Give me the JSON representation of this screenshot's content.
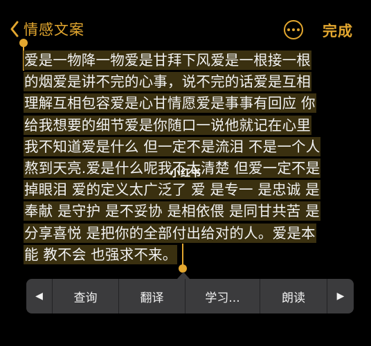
{
  "nav": {
    "back_label": "情感文案",
    "back_icon": "chevron-left-icon",
    "more_icon": "ellipsis-circle-icon",
    "done_label": "完成",
    "accent_color": "#e3a72f"
  },
  "note": {
    "lines": [
      "爱是一物降一物爱是甘拜下风爱是一根接一根",
      "的烟爱是讲不完的心事，说不完的话爱是互相",
      "理解互相包容爱是心甘情愿爱是事事有回应 你",
      "给我想要的细节爱是你随口一说他就记在心里",
      "我不知道爱是什么 但一定不是流泪 不是一个人",
      "熬到天亮.爱是什么呢我不太清楚 但爱一定不是",
      "掉眼泪 爱的定义太广泛了 爱 是专一 是忠诚 是",
      "奉献 是守护 是不妥协 是相依偎 是同甘共苦 是",
      "分享喜悦 是把你的全部付出给对的人。爱是本",
      "能 教不会 也强求不来。"
    ],
    "watermark": "小红书"
  },
  "menu": {
    "prev_icon": "triangle-left-icon",
    "next_icon": "triangle-right-icon",
    "items": [
      "查询",
      "翻译",
      "学习...",
      "朗读"
    ],
    "bg_color": "#3b3b3d"
  }
}
